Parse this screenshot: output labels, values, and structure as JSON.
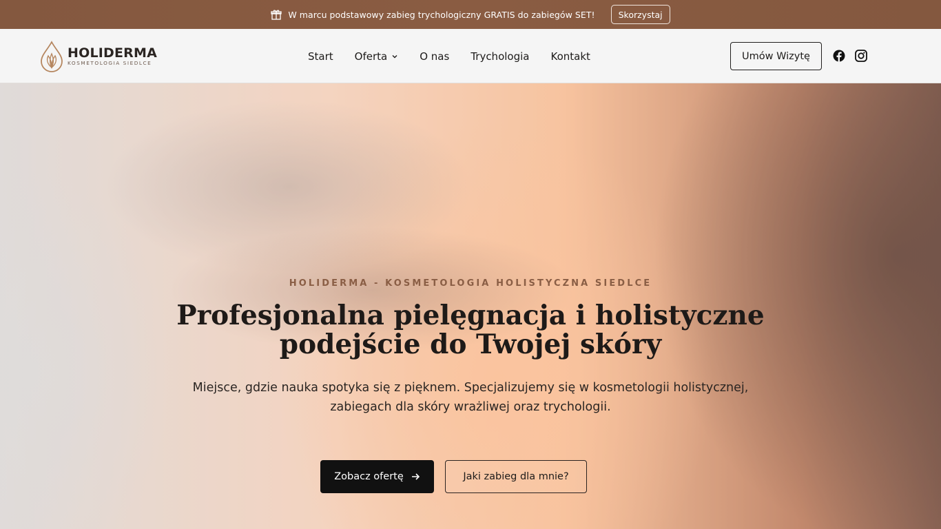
{
  "promo": {
    "text": "W marcu podstawowy zabieg trychologiczny GRATIS do zabiegów SET!",
    "cta": "Skorzystaj",
    "icon": "gift-icon"
  },
  "header": {
    "logo": {
      "brand": "HOLIDERMA",
      "tagline": "KOSMETOLOGIA SIEDLCE"
    },
    "nav": [
      {
        "label": "Start"
      },
      {
        "label": "Oferta",
        "icon": "chevron-down-icon"
      },
      {
        "label": "O nas"
      },
      {
        "label": "Trychologia"
      },
      {
        "label": "Kontakt"
      }
    ],
    "book_label": "Umów Wizytę",
    "social": [
      "facebook-icon",
      "instagram-icon"
    ]
  },
  "hero": {
    "eyebrow": "HOLIDERMA - KOSMETOLOGIA HOLISTYCZNA SIEDLCE",
    "title_line1": "Profesjonalna pielęgnacja i holistyczne",
    "title_line2": "podejście do Twojej skóry",
    "lead_line1": "Miejsce, gdzie nauka spotyka się z pięknem. Specjalizujemy się w kosmetologii holistycznej,",
    "lead_line2": "zabiegach dla skóry wrażliwej oraz trychologii.",
    "primary_button": "Zobacz ofertę",
    "secondary_button": "Jaki zabieg dla mnie?"
  },
  "colors": {
    "promo_bg": "#8a5c42",
    "accent": "#8a5e45",
    "dark": "#111111"
  }
}
